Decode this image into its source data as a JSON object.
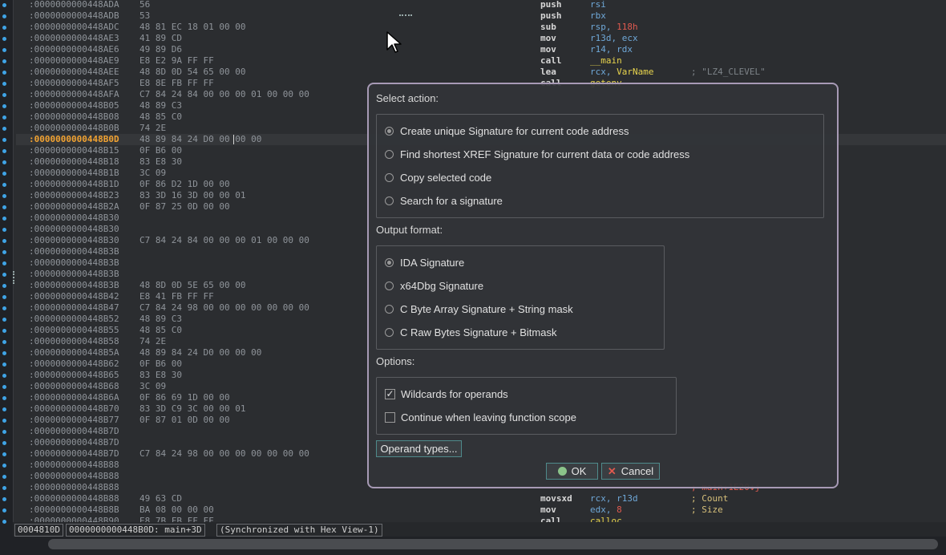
{
  "listing": {
    "rows": [
      {
        "addr": ":0000000000448ADA",
        "bytes": "56"
      },
      {
        "addr": ":0000000000448ADB",
        "bytes": "53"
      },
      {
        "addr": ":0000000000448ADC",
        "bytes": "48 81 EC 18 01 00 00"
      },
      {
        "addr": ":0000000000448AE3",
        "bytes": "41 89 CD"
      },
      {
        "addr": ":0000000000448AE6",
        "bytes": "49 89 D6"
      },
      {
        "addr": ":0000000000448AE9",
        "bytes": "E8 E2 9A FF FF"
      },
      {
        "addr": ":0000000000448AEE",
        "bytes": "48 8D 0D 54 65 00 00"
      },
      {
        "addr": ":0000000000448AF5",
        "bytes": "E8 8E FB FF FF"
      },
      {
        "addr": ":0000000000448AFA",
        "bytes": "C7 84 24 84 00 00 00 01 00 00 00"
      },
      {
        "addr": ":0000000000448B05",
        "bytes": "48 89 C3"
      },
      {
        "addr": ":0000000000448B08",
        "bytes": "48 85 C0"
      },
      {
        "addr": ":0000000000448B0B",
        "bytes": "74 2E"
      },
      {
        "addr": ":0000000000448B0D",
        "bytes": "48 89 84 24 D0 00 00 00",
        "current": true
      },
      {
        "addr": ":0000000000448B15",
        "bytes": "0F B6 00"
      },
      {
        "addr": ":0000000000448B18",
        "bytes": "83 E8 30"
      },
      {
        "addr": ":0000000000448B1B",
        "bytes": "3C 09"
      },
      {
        "addr": ":0000000000448B1D",
        "bytes": "0F 86 D2 1D 00 00"
      },
      {
        "addr": ":0000000000448B23",
        "bytes": "83 3D 16 3D 00 00 01"
      },
      {
        "addr": ":0000000000448B2A",
        "bytes": "0F 87 25 0D 00 00"
      },
      {
        "addr": ":0000000000448B30",
        "bytes": ""
      },
      {
        "addr": ":0000000000448B30",
        "bytes": ""
      },
      {
        "addr": ":0000000000448B30",
        "bytes": "C7 84 24 84 00 00 00 01 00 00 00"
      },
      {
        "addr": ":0000000000448B3B",
        "bytes": ""
      },
      {
        "addr": ":0000000000448B3B",
        "bytes": ""
      },
      {
        "addr": ":0000000000448B3B",
        "bytes": ""
      },
      {
        "addr": ":0000000000448B3B",
        "bytes": "48 8D 0D 5E 65 00 00"
      },
      {
        "addr": ":0000000000448B42",
        "bytes": "E8 41 FB FF FF"
      },
      {
        "addr": ":0000000000448B47",
        "bytes": "C7 84 24 98 00 00 00 00 00 00 00"
      },
      {
        "addr": ":0000000000448B52",
        "bytes": "48 89 C3"
      },
      {
        "addr": ":0000000000448B55",
        "bytes": "48 85 C0"
      },
      {
        "addr": ":0000000000448B58",
        "bytes": "74 2E"
      },
      {
        "addr": ":0000000000448B5A",
        "bytes": "48 89 84 24 D0 00 00 00"
      },
      {
        "addr": ":0000000000448B62",
        "bytes": "0F B6 00"
      },
      {
        "addr": ":0000000000448B65",
        "bytes": "83 E8 30"
      },
      {
        "addr": ":0000000000448B68",
        "bytes": "3C 09"
      },
      {
        "addr": ":0000000000448B6A",
        "bytes": "0F 86 69 1D 00 00"
      },
      {
        "addr": ":0000000000448B70",
        "bytes": "83 3D C9 3C 00 00 01"
      },
      {
        "addr": ":0000000000448B77",
        "bytes": "0F 87 01 0D 00 00"
      },
      {
        "addr": ":0000000000448B7D",
        "bytes": ""
      },
      {
        "addr": ":0000000000448B7D",
        "bytes": ""
      },
      {
        "addr": ":0000000000448B7D",
        "bytes": "C7 84 24 98 00 00 00 00 00 00 00"
      },
      {
        "addr": ":0000000000448B88",
        "bytes": ""
      },
      {
        "addr": ":0000000000448B88",
        "bytes": ""
      },
      {
        "addr": ":0000000000448B88",
        "bytes": ""
      },
      {
        "addr": ":0000000000448B88",
        "bytes": "49 63 CD"
      },
      {
        "addr": ":0000000000448B8B",
        "bytes": "BA 08 00 00 00"
      },
      {
        "addr": ":0000000000448B90",
        "bytes": "E8 7B FB FF FF"
      }
    ],
    "disasm_top": [
      {
        "mnem": "push",
        "ops": "rsi"
      },
      {
        "mnem": "push",
        "ops": "rbx"
      },
      {
        "mnem": "sub",
        "ops": "rsp, 118h"
      },
      {
        "mnem": "mov",
        "ops": "r13d, ecx"
      },
      {
        "mnem": "mov",
        "ops": "r14, rdx"
      },
      {
        "mnem": "call",
        "ops": "__main"
      },
      {
        "mnem": "lea",
        "ops": "rcx, VarName",
        "comment": "; \"LZ4_CLEVEL\""
      },
      {
        "mnem": "call",
        "ops": "getenv"
      }
    ],
    "disasm_bottom": [
      {
        "mnem": "",
        "ops": "",
        "comment": "; main+1E20↓j"
      },
      {
        "mnem": "movsxd",
        "ops": "rcx, r13d",
        "comment": "; Count"
      },
      {
        "mnem": "mov",
        "ops": "edx, 8",
        "comment": "; Size"
      },
      {
        "mnem": "call",
        "ops": "calloc"
      }
    ]
  },
  "dialog": {
    "select_action_label": "Select action:",
    "actions": [
      {
        "label": "Create unique Signature for current code address",
        "selected": true
      },
      {
        "label": "Find shortest XREF Signature for current data or code address",
        "selected": false
      },
      {
        "label": "Copy selected code",
        "selected": false
      },
      {
        "label": "Search for a signature",
        "selected": false
      }
    ],
    "output_format_label": "Output format:",
    "formats": [
      {
        "label": "IDA Signature",
        "selected": true
      },
      {
        "label": "x64Dbg Signature",
        "selected": false
      },
      {
        "label": "C Byte Array Signature + String mask",
        "selected": false
      },
      {
        "label": "C Raw Bytes Signature + Bitmask",
        "selected": false
      }
    ],
    "options_label": "Options:",
    "options": [
      {
        "label": "Wildcards for operands",
        "checked": true,
        "mark": "✓"
      },
      {
        "label": "Continue when leaving function scope",
        "checked": false,
        "mark": ""
      }
    ],
    "operand_types_button": "Operand types...",
    "ok_button": "OK",
    "cancel_button": "Cancel"
  },
  "statusbar": {
    "offset": "0004810D",
    "location": "0000000000448B0D: main+3D",
    "sync": "(Synchronized with Hex View-1)"
  },
  "colors": {
    "accent_border": "#a79ab5",
    "current_address": "#f2a332",
    "ok_icon": "#8bc48a",
    "cancel_icon": "#e05a4f",
    "button_border": "#4f8a8b"
  }
}
